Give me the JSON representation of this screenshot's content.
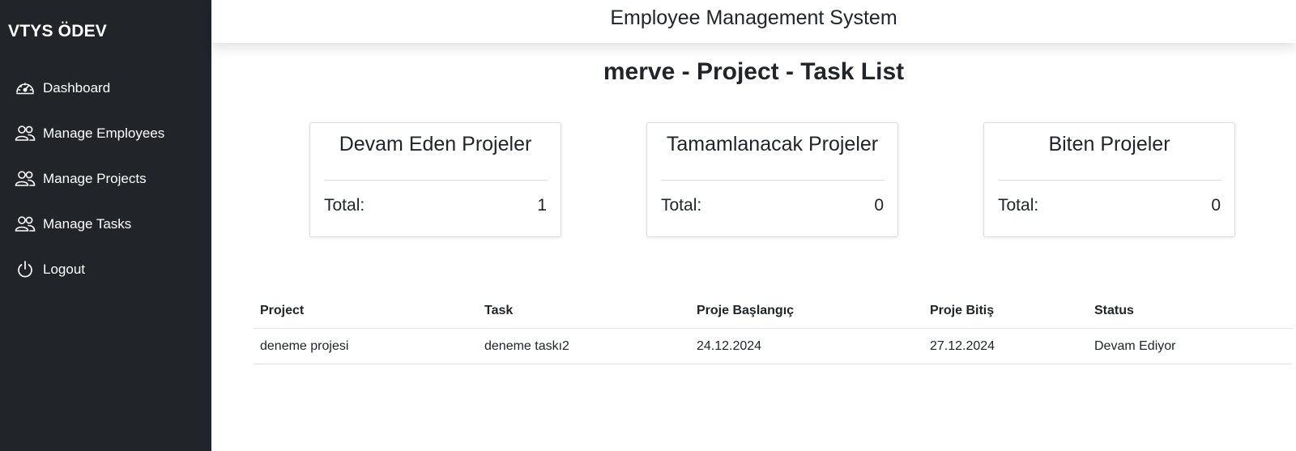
{
  "sidebar": {
    "brand": "VTYS ÖDEV",
    "items": [
      {
        "label": "Dashboard",
        "icon": "speedometer-icon"
      },
      {
        "label": "Manage Employees",
        "icon": "people-icon"
      },
      {
        "label": "Manage Projects",
        "icon": "people-icon"
      },
      {
        "label": "Manage Tasks",
        "icon": "people-icon"
      },
      {
        "label": "Logout",
        "icon": "power-icon"
      }
    ]
  },
  "header": {
    "title": "Employee Management System"
  },
  "page": {
    "title": "merve - Project - Task List"
  },
  "cards": [
    {
      "title": "Devam Eden Projeler",
      "total_label": "Total:",
      "total_value": "1"
    },
    {
      "title": "Tamamlanacak Projeler",
      "total_label": "Total:",
      "total_value": "0"
    },
    {
      "title": "Biten Projeler",
      "total_label": "Total:",
      "total_value": "0"
    }
  ],
  "table": {
    "headers": [
      "Project",
      "Task",
      "Proje Başlangıç",
      "Proje Bitiş",
      "Status"
    ],
    "rows": [
      [
        "deneme projesi",
        "deneme taskı2",
        "24.12.2024",
        "27.12.2024",
        "Devam Ediyor"
      ]
    ]
  },
  "colors": {
    "sidebar_bg": "#212529",
    "text": "#212529",
    "background": "#ffffff"
  }
}
